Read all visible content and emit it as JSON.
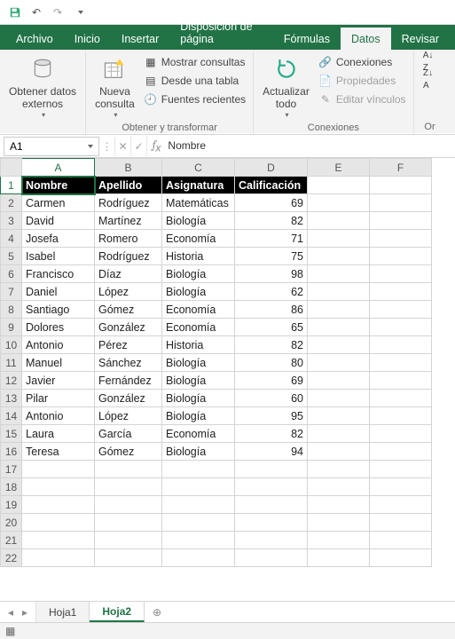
{
  "qat": {
    "save": "💾",
    "undo": "↶",
    "redo": "↷"
  },
  "tabs": [
    "Archivo",
    "Inicio",
    "Insertar",
    "Disposición de página",
    "Fórmulas",
    "Datos",
    "Revisar"
  ],
  "active_tab": 5,
  "ribbon": {
    "g1": {
      "label": "",
      "btn": "Obtener datos\nexternos"
    },
    "g2": {
      "label": "Obtener y transformar",
      "btn": "Nueva\nconsulta",
      "cmds": [
        "Mostrar consultas",
        "Desde una tabla",
        "Fuentes recientes"
      ]
    },
    "g3": {
      "label": "Conexiones",
      "btn": "Actualizar\ntodo",
      "cmds": [
        "Conexiones",
        "Propiedades",
        "Editar vínculos"
      ]
    },
    "g4": {
      "cmds": [
        "",
        "Or"
      ]
    }
  },
  "namebox": "A1",
  "formula": "Nombre",
  "columns": [
    "A",
    "B",
    "C",
    "D",
    "E",
    "F"
  ],
  "headers": [
    "Nombre",
    "Apellido",
    "Asignatura",
    "Calificación"
  ],
  "data": [
    [
      "Carmen",
      "Rodríguez",
      "Matemáticas",
      69
    ],
    [
      "David",
      "Martínez",
      "Biología",
      82
    ],
    [
      "Josefa",
      "Romero",
      "Economía",
      71
    ],
    [
      "Isabel",
      "Rodríguez",
      "Historia",
      75
    ],
    [
      "Francisco",
      "Díaz",
      "Biología",
      98
    ],
    [
      "Daniel",
      "López",
      "Biología",
      62
    ],
    [
      "Santiago",
      "Gómez",
      "Economía",
      86
    ],
    [
      "Dolores",
      "González",
      "Economía",
      65
    ],
    [
      "Antonio",
      "Pérez",
      "Historia",
      82
    ],
    [
      "Manuel",
      "Sánchez",
      "Biología",
      80
    ],
    [
      "Javier",
      "Fernández",
      "Biología",
      69
    ],
    [
      "Pilar",
      "González",
      "Biología",
      60
    ],
    [
      "Antonio",
      "López",
      "Biología",
      95
    ],
    [
      "Laura",
      "García",
      "Economía",
      82
    ],
    [
      "Teresa",
      "Gómez",
      "Biología",
      94
    ]
  ],
  "empty_rows": 6,
  "sheets": [
    "Hoja1",
    "Hoja2"
  ],
  "active_sheet": 1,
  "status_icon": "▦"
}
